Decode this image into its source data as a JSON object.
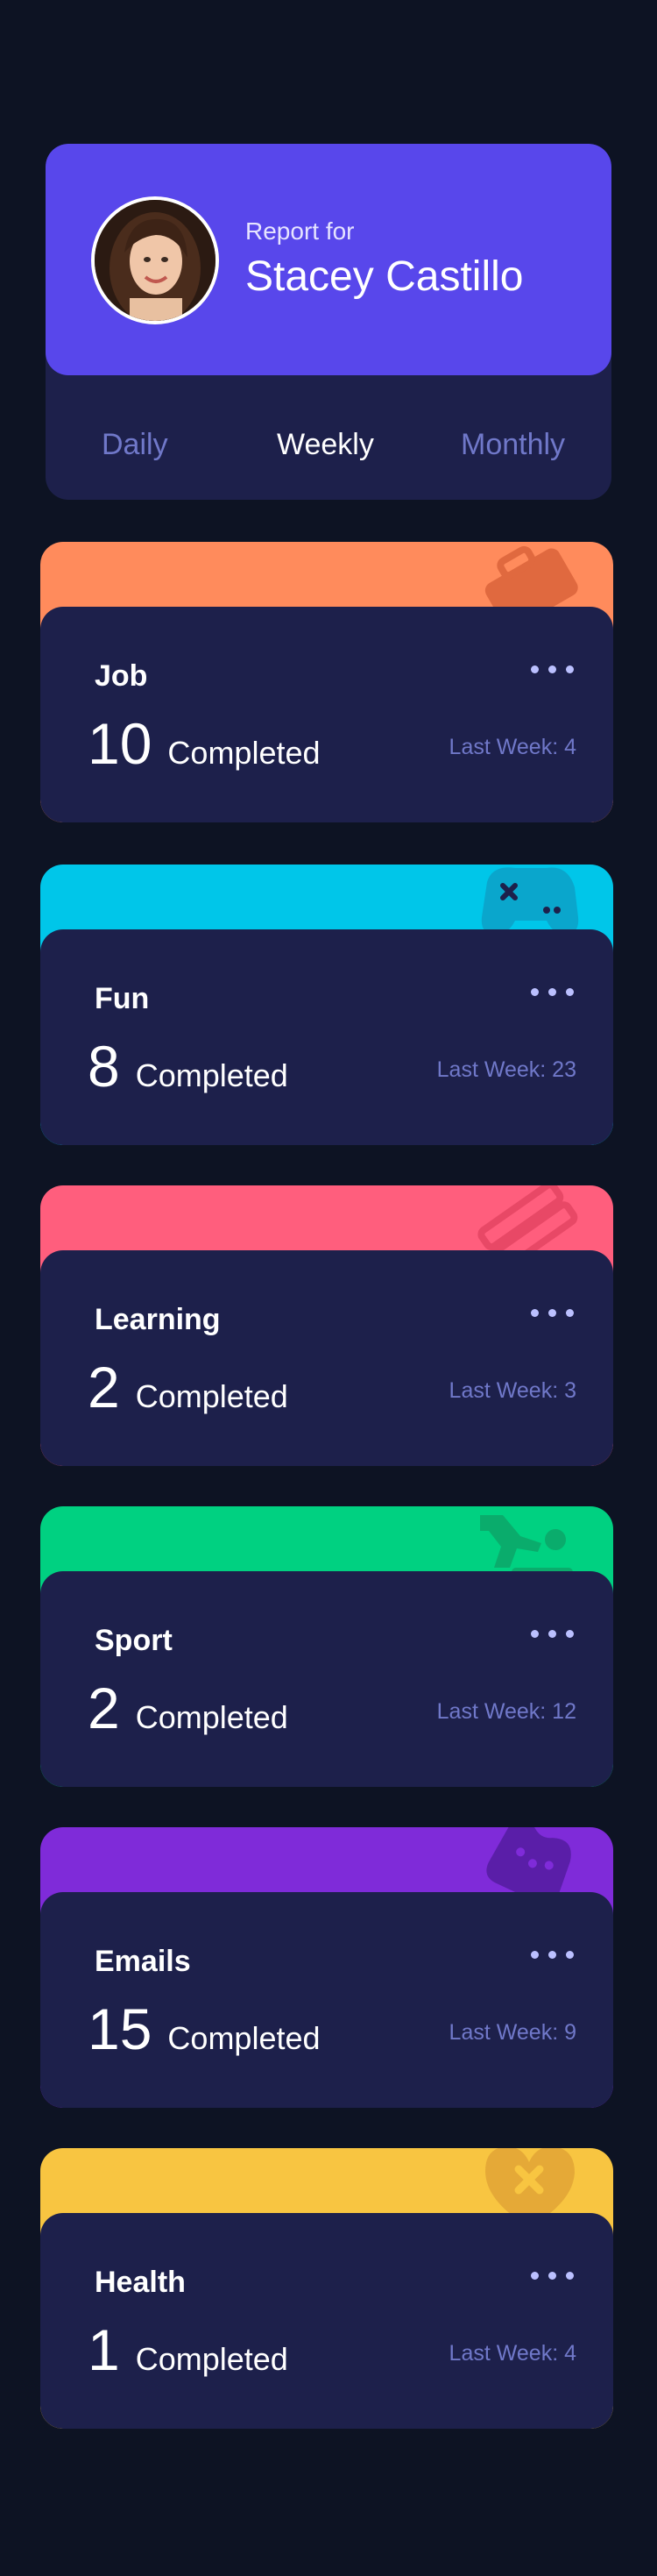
{
  "profile": {
    "report_for": "Report for",
    "name": "Stacey Castillo",
    "tabs": [
      {
        "label": "Daily",
        "active": false
      },
      {
        "label": "Weekly",
        "active": true
      },
      {
        "label": "Monthly",
        "active": false
      }
    ]
  },
  "cards": [
    {
      "title": "Job",
      "value": "10",
      "unit": "Completed",
      "last": "Last Week: 4",
      "color": "#ff8b5c",
      "icon": "briefcase-icon"
    },
    {
      "title": "Fun",
      "value": "8",
      "unit": "Completed",
      "last": "Last Week: 23",
      "color": "#00c6e9",
      "icon": "gamepad-icon"
    },
    {
      "title": "Learning",
      "value": "2",
      "unit": "Completed",
      "last": "Last Week: 3",
      "color": "#ff5e7d",
      "icon": "books-icon"
    },
    {
      "title": "Sport",
      "value": "2",
      "unit": "Completed",
      "last": "Last Week: 12",
      "color": "#00d181",
      "icon": "runner-icon"
    },
    {
      "title": "Emails",
      "value": "15",
      "unit": "Completed",
      "last": "Last Week: 9",
      "color": "#7f2bd9",
      "icon": "email-icon"
    },
    {
      "title": "Health",
      "value": "1",
      "unit": "Completed",
      "last": "Last Week: 4",
      "color": "#f8c541",
      "icon": "heart-icon"
    }
  ]
}
